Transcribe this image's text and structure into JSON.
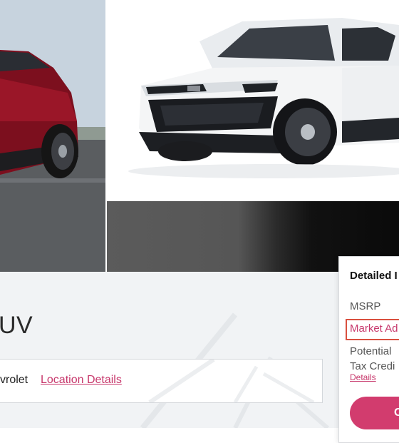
{
  "vehicle": {
    "title_fragment": "UV"
  },
  "dealer": {
    "name_fragment": "vrolet",
    "location_link": "Location Details"
  },
  "pricing_card": {
    "heading": "Detailed I",
    "msrp_label": "MSRP",
    "market_label": "Market Ad",
    "potential_label_line1": "Potential",
    "potential_label_line2": "Tax Credi",
    "details_link": "Details",
    "cta_label": "C"
  },
  "images": [
    {
      "name": "red-suv-photo",
      "icon": "car-photo-red"
    },
    {
      "name": "white-suv-photo",
      "icon": "car-photo-white"
    },
    {
      "name": "dark-interior-photo",
      "icon": "car-photo-dark"
    }
  ],
  "colors": {
    "accent": "#c7376b",
    "cta_background": "#d23c6e",
    "highlight_border": "#d9503f",
    "info_background": "#f1f3f5"
  }
}
